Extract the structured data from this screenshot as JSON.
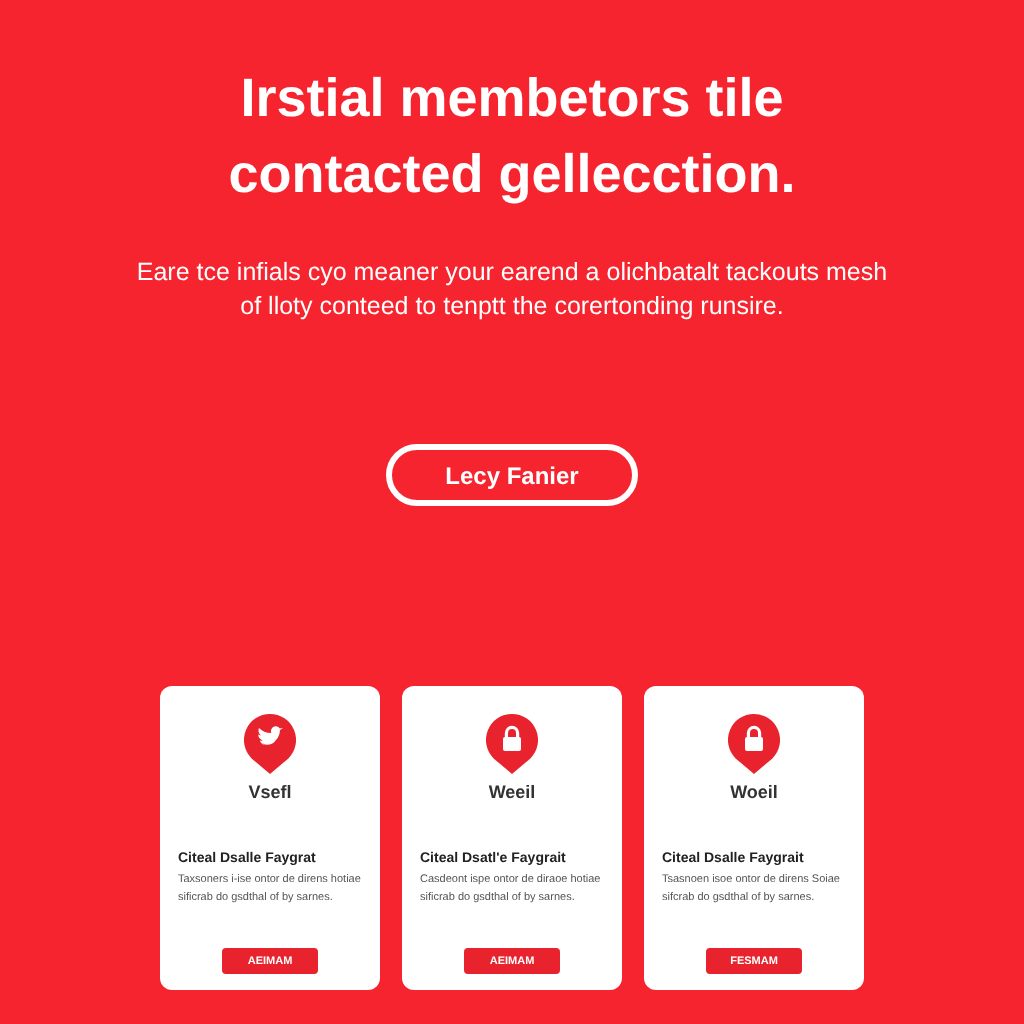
{
  "hero": {
    "title": "Irstial membetors tile contacted gellecction.",
    "subtitle": "Eare tce infials cyo meaner your earend a olichbatalt tackouts mesh of lloty conteed to tenptt the corertonding runsire.",
    "button": "Lecy Fanier"
  },
  "cards": [
    {
      "kind": "bird",
      "label": "Vsefl",
      "heading": "Citeal Dsalle Faygrat",
      "body": "Taxsoners i-ise ontor de direns hotiae sificrab do gsdthal of by sarnes.",
      "button": "AEIMAM"
    },
    {
      "kind": "lock",
      "label": "Weeil",
      "heading": "Citeal Dsatl'e Faygrait",
      "body": "Casdeont ispe ontor de diraoe hotiae sificrab do gsdthal of by sarnes.",
      "button": "AEIMAM"
    },
    {
      "kind": "lock",
      "label": "Woeil",
      "heading": "Citeal Dsalle Faygrait",
      "body": "Tsasnoen isoe ontor de direns Soiae sifcrab do gsdthal of by sarnes.",
      "button": "FESMAM"
    }
  ]
}
